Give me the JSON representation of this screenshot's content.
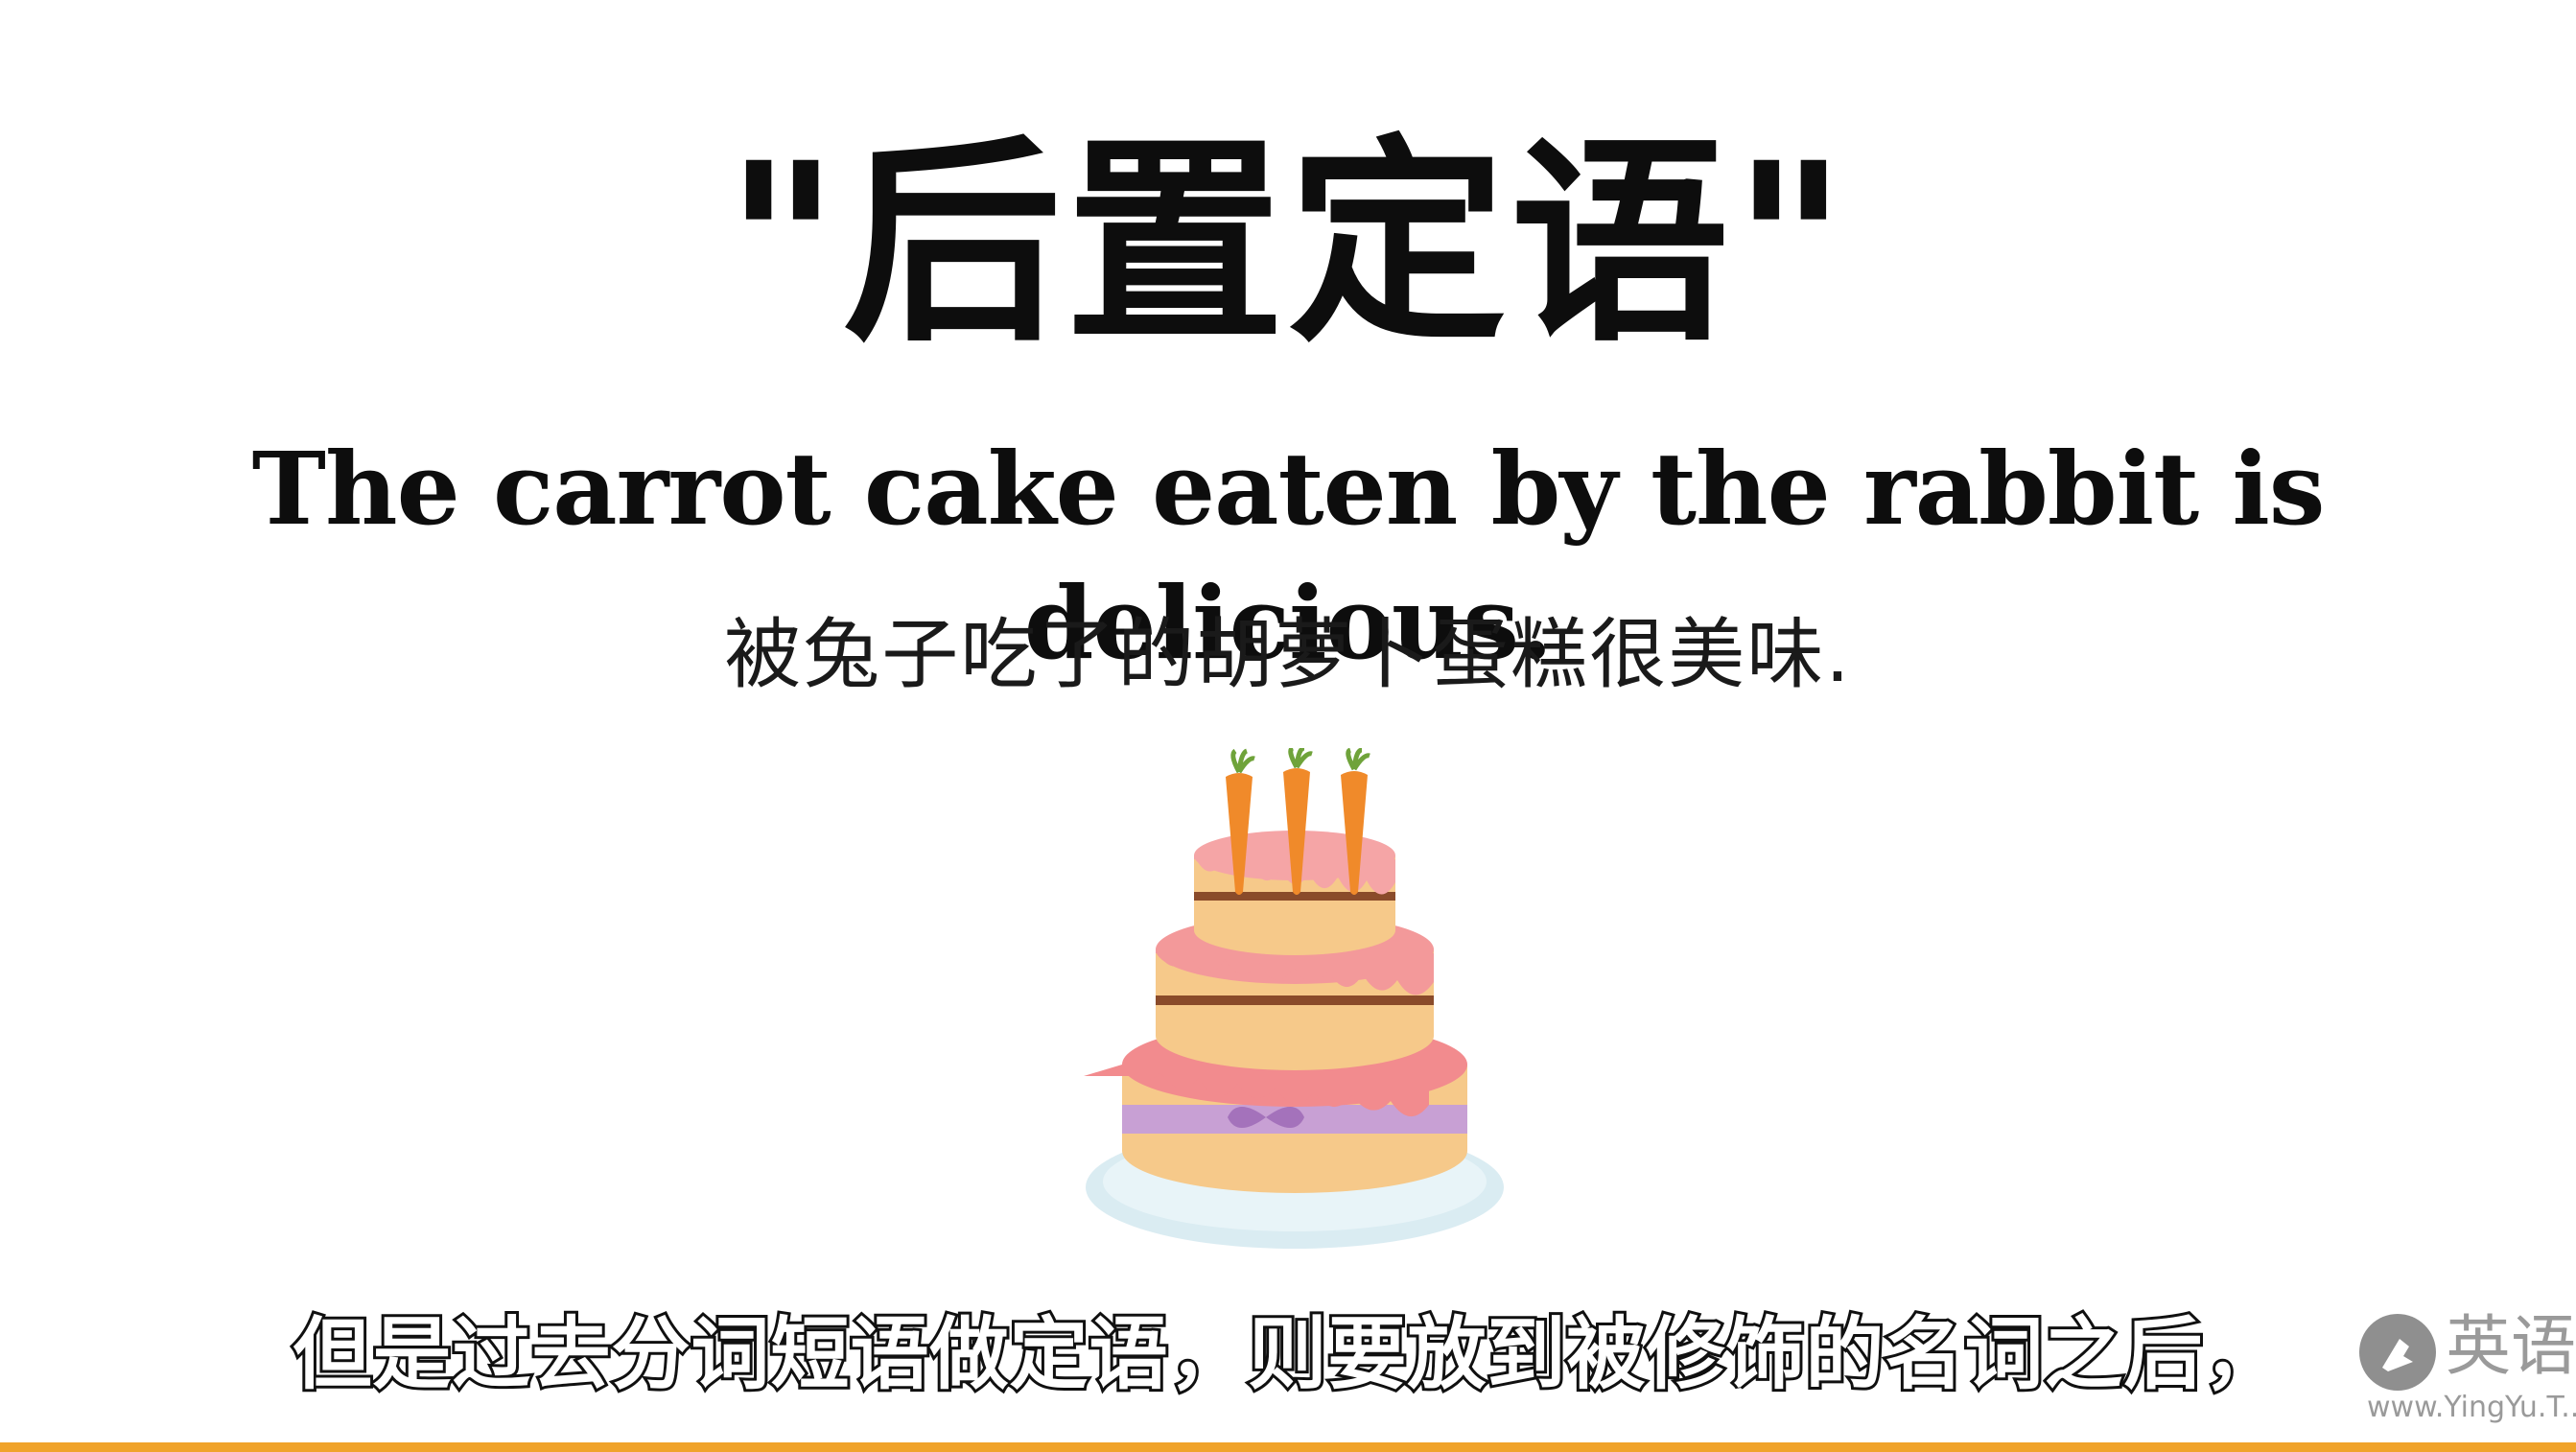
{
  "slide": {
    "title": "\"后置定语\"",
    "sentence": "The carrot cake eaten by the rabbit is delicious.",
    "translation": "被兔子吃了的胡萝卜蛋糕很美味.",
    "illustration": "carrot-cake-illustration"
  },
  "subtitle": {
    "text": "但是过去分词短语做定语，则要放到被修饰的名词之后，"
  },
  "watermark": {
    "brand": "英语",
    "url": "www.YingYu.T..."
  },
  "colors": {
    "background": "#ffffff",
    "text": "#0d0d0d",
    "accent_bar": "#f0a32a",
    "cake_pink": "#f2898a",
    "cake_sponge": "#f6c98a",
    "carrot": "#f08a2a",
    "ribbon": "#b58ac6",
    "plate": "#cfe6ee"
  }
}
